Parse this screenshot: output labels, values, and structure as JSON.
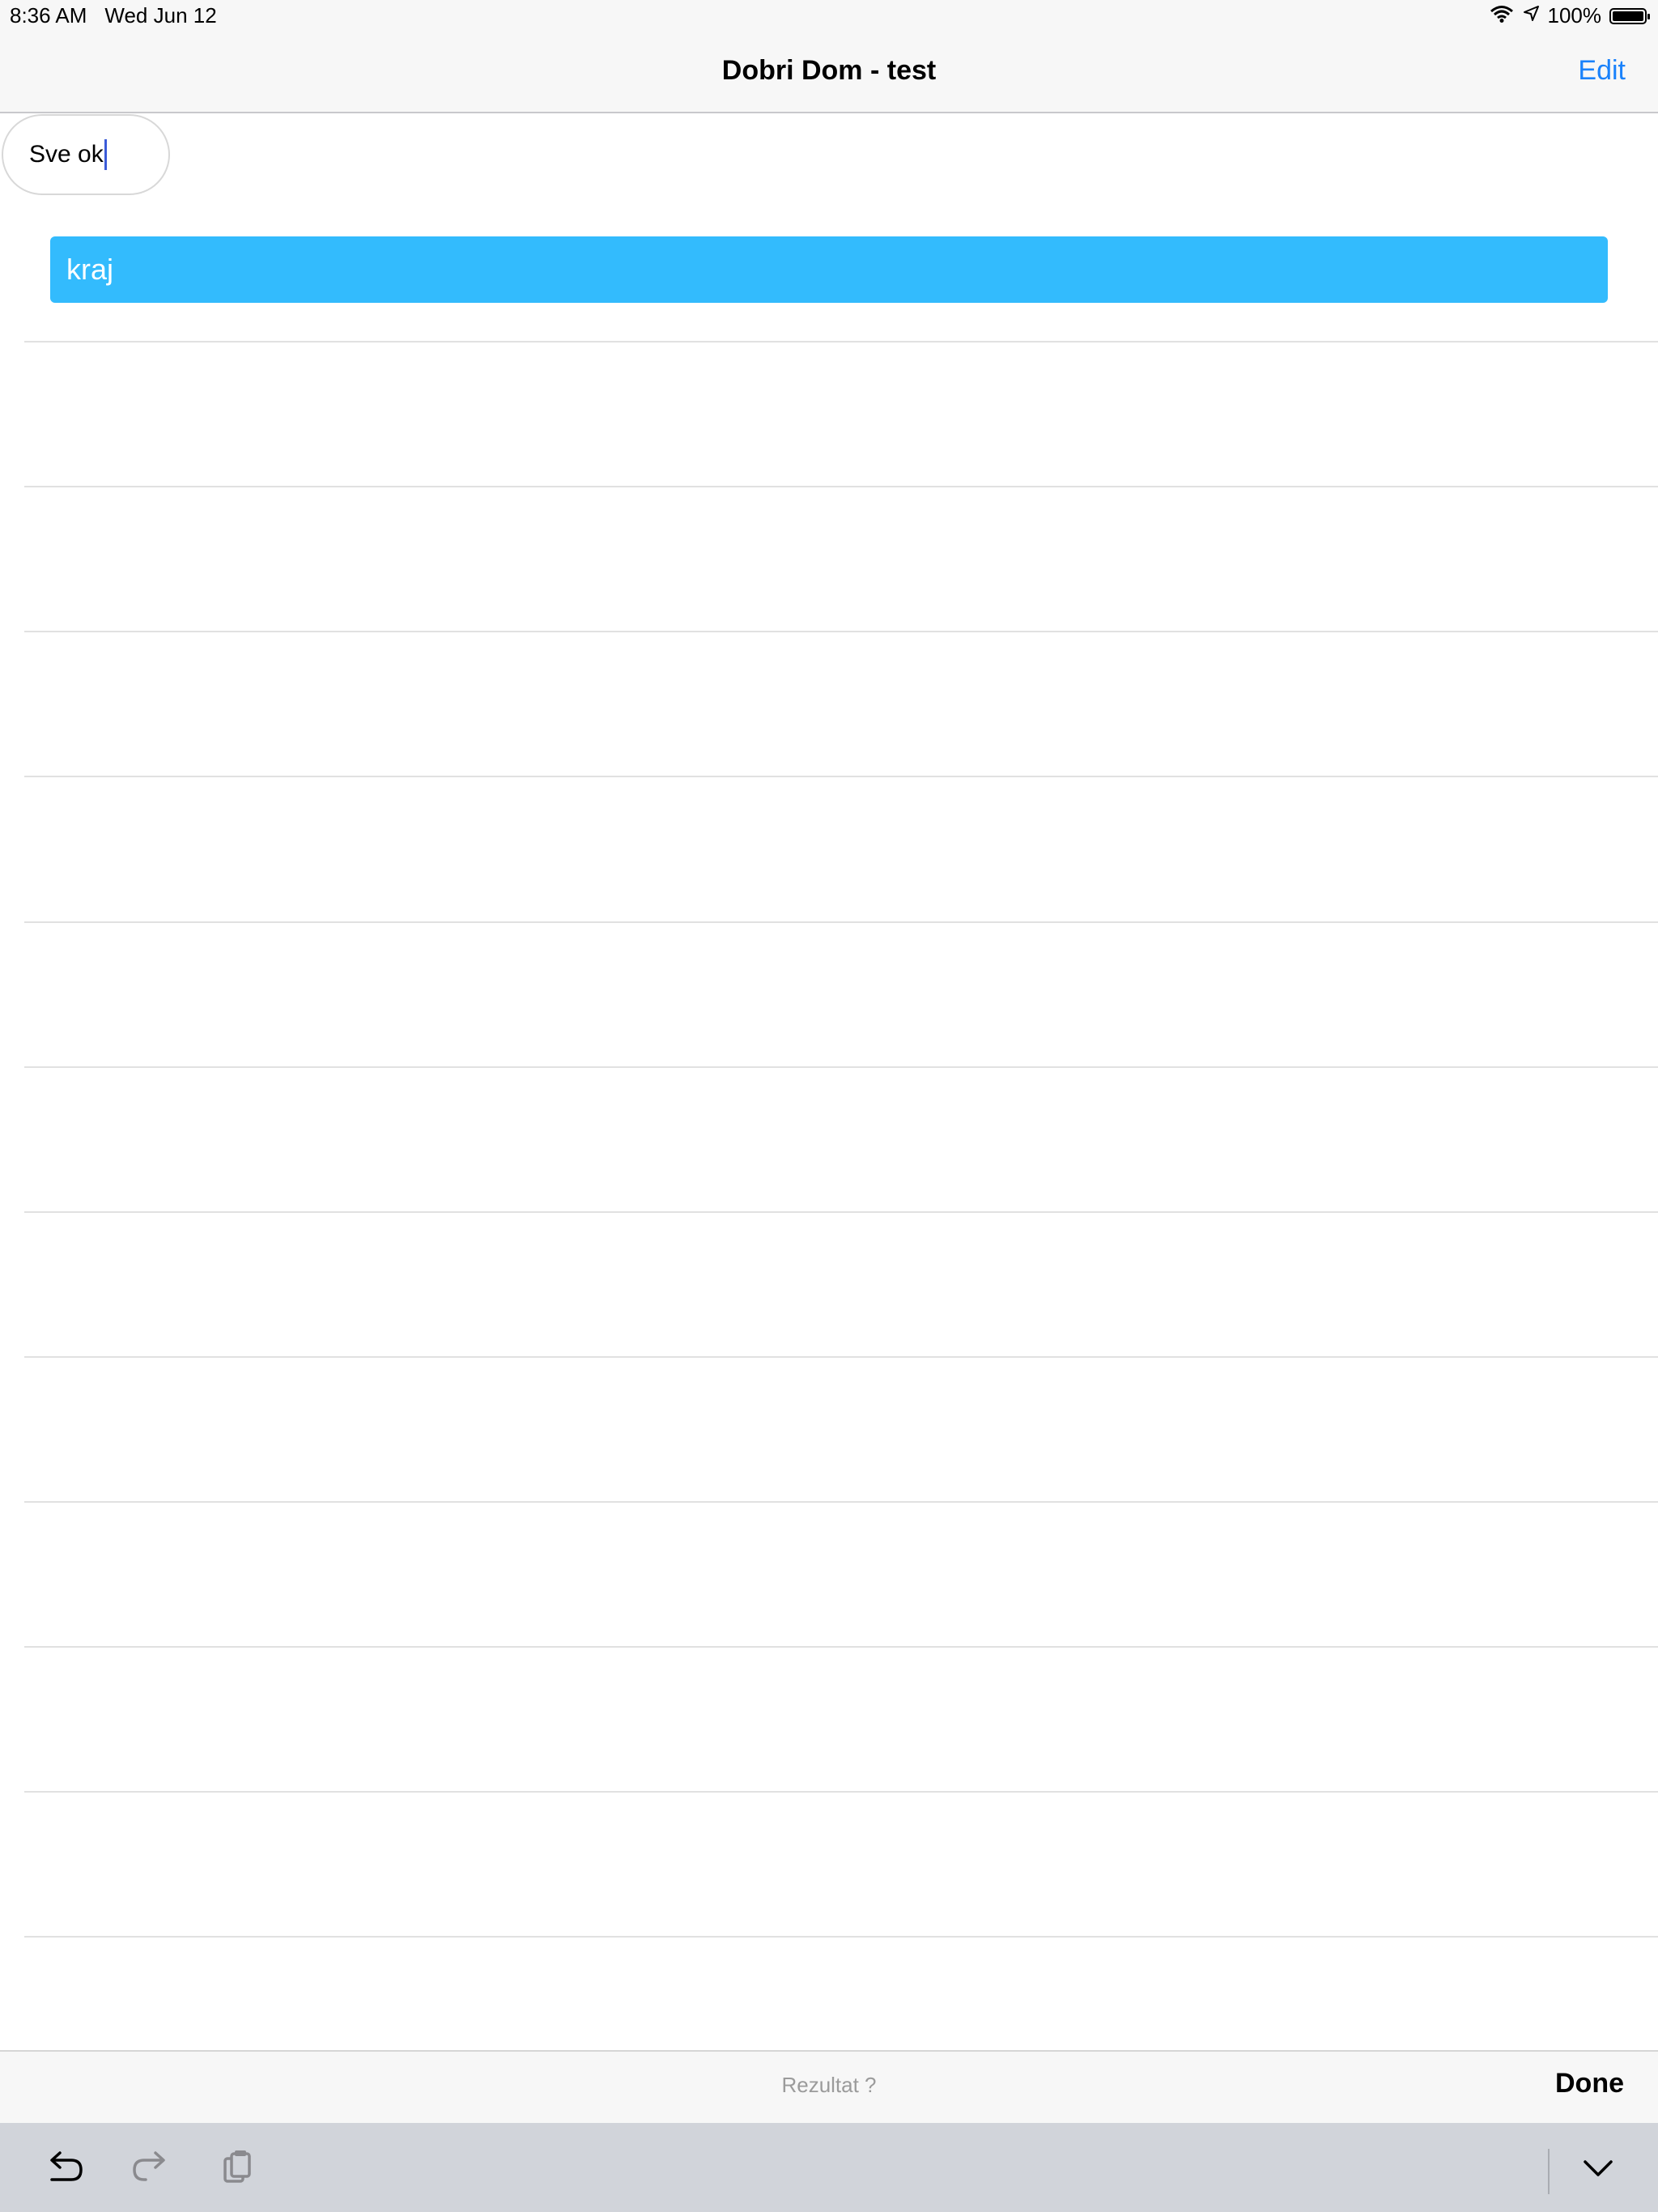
{
  "status_bar": {
    "time": "8:36 AM",
    "date": "Wed Jun 12",
    "battery": "100%"
  },
  "nav": {
    "title": "Dobri Dom - test",
    "edit_label": "Edit"
  },
  "input": {
    "value": "Sve ok"
  },
  "list": {
    "highlighted_item": "kraj"
  },
  "accessory": {
    "placeholder": "Rezultat ?",
    "done_label": "Done"
  },
  "icons": {
    "wifi": "wifi-icon",
    "location": "location-arrow-icon",
    "battery": "battery-icon",
    "undo": "undo-icon",
    "redo": "redo-icon",
    "paste": "paste-icon",
    "dismiss": "chevron-down-icon"
  },
  "colors": {
    "accent": "#1a82fb",
    "highlight_row": "#33bbfd",
    "caret": "#3b5bd8"
  }
}
